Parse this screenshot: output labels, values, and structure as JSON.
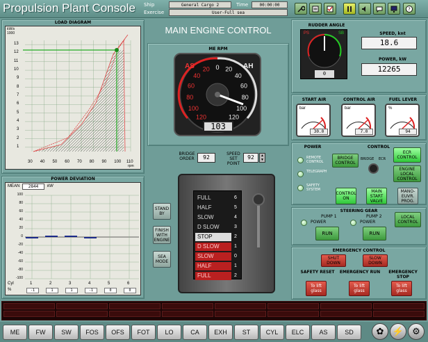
{
  "app": {
    "title": "Propulsion Plant Console"
  },
  "header": {
    "ship_label": "Ship",
    "ship_value": "General Cargo 2",
    "time_label": "Time",
    "time_value": "00:00:00",
    "exercise_label": "Exercise",
    "exercise_value": "User-Full sea"
  },
  "toolbar_icons": [
    "wrench-icon",
    "checklist-icon",
    "checkbox-icon",
    "pause-icon",
    "speaker-icon",
    "chat-icon",
    "monitor-icon",
    "help-icon"
  ],
  "load_diagram": {
    "title": "LOAD DIAGRAM",
    "ylabel": "kW/s",
    "y_top": "1000",
    "xlabel": "rpm",
    "x_ticks": [
      "30",
      "40",
      "50",
      "60",
      "70",
      "80",
      "90",
      "100",
      "110"
    ],
    "y_ticks": [
      "1",
      "2",
      "3",
      "4",
      "5",
      "6",
      "7",
      "8",
      "9",
      "10",
      "11",
      "12",
      "13"
    ]
  },
  "power_deviation": {
    "title": "POWER DEVIATION",
    "mean_label": "MEAN",
    "mean_value": "2844",
    "unit": "kW",
    "y_ticks": [
      "100",
      "80",
      "60",
      "40",
      "20",
      "0",
      "-20",
      "-40",
      "-60",
      "-80",
      "-100"
    ],
    "cyl_label": "Cyl",
    "pct_label": "%",
    "cylinders": [
      "1",
      "2",
      "3",
      "4",
      "5",
      "6"
    ],
    "deviations": [
      "-1",
      "1",
      "1",
      "-1",
      "0",
      "0"
    ]
  },
  "main": {
    "title": "MAIN ENGINE CONTROL",
    "rpm_title": "ME RPM",
    "as_label": "AS",
    "ah_label": "AH",
    "rpm_value": "103",
    "bridge_order_label": "BRIDGE ORDER",
    "bridge_order_value": "92",
    "speed_set_label": "SPEED SET POINT",
    "speed_set_value": "92",
    "telegraph_positions": [
      "FULL",
      "HALF",
      "SLOW",
      "D SLOW",
      "STOP",
      "D SLOW",
      "SLOW",
      "HALF",
      "FULL"
    ],
    "telegraph_numbers": [
      "6",
      "5",
      "4",
      "3",
      "2",
      "1",
      "0",
      "1",
      "2",
      "3",
      "4",
      "5",
      "6"
    ],
    "side_buttons": [
      "STAND BY",
      "FINISH WITH ENGINE",
      "SEA MODE"
    ]
  },
  "rudder": {
    "title": "RUDDER ANGLE",
    "ps": "PS",
    "sb": "SB",
    "value": "0"
  },
  "speed": {
    "label": "SPEED, knt",
    "value": "18.6"
  },
  "power": {
    "label": "POWER, kW",
    "value": "12265"
  },
  "air": {
    "start_air": {
      "title": "START AIR",
      "unit": "bar",
      "value": "30.0"
    },
    "control_air": {
      "title": "CONTROL AIR",
      "unit": "bar",
      "value": "7.0"
    },
    "fuel_lever": {
      "title": "FUEL LEVER",
      "unit": "%",
      "value": "94"
    }
  },
  "power_select": {
    "title": "POWER",
    "items": [
      "REMOTE CONTROL",
      "TELEGRAPH",
      "SAFETY SYSTEM"
    ]
  },
  "control": {
    "title": "CONTROL",
    "bridge_control": "BRIDGE CONTROL",
    "bridge_label": "BRIDGE",
    "ecr_label": "ECR",
    "ecr_control": "ECR CONTROL",
    "engine_local": "ENGINE LOCAL CONTROL",
    "control_on": "CONTROL ON",
    "main_start": "MAIN START VALVE",
    "mano_prog": "MANO-EUVR. PROG."
  },
  "steering": {
    "title": "STEERING GEAR",
    "pump1": "PUMP 1",
    "pump2": "PUMP 2",
    "power": "POWER",
    "run": "RUN",
    "local_control": "LOCAL CONTROL"
  },
  "emergency": {
    "title": "EMERGENCY CONTROL",
    "shut_down": "SHUT DOWN",
    "slow_down": "SLOW DOWN",
    "safety_reset": "SAFETY RESET",
    "emergency_run": "EMERGENCY RUN",
    "emergency_stop": "EMERGENCY STOP",
    "lift_glass": "To lift glass"
  },
  "bottom_tabs": [
    "ME",
    "FW",
    "SW",
    "FOS",
    "OFS",
    "FOT",
    "LO",
    "CA",
    "EXH",
    "ST",
    "CYL",
    "ELC",
    "AS",
    "SD"
  ],
  "colors": {
    "background": "#6f9d98",
    "accent_green": "#3d9a3d",
    "alarm_red": "#a62a22"
  }
}
